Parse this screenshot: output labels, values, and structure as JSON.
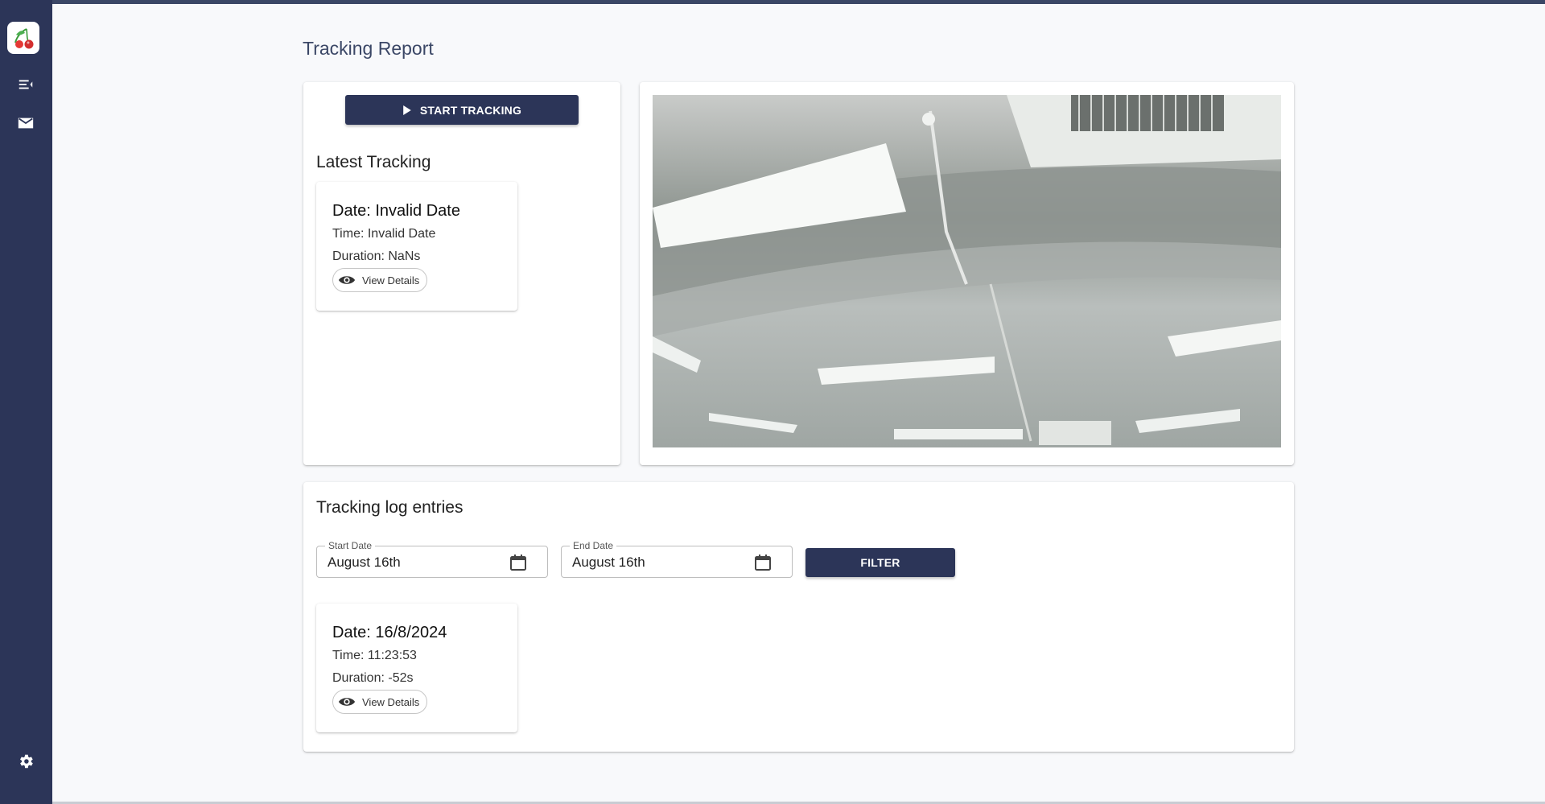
{
  "sidebar": {
    "logo_icon": "cherry-logo",
    "items": [
      {
        "icon": "menu-collapse-icon"
      },
      {
        "icon": "mail-icon"
      }
    ],
    "footer_icon": "gear-icon",
    "color": "#2c3558"
  },
  "page": {
    "title": "Tracking Report"
  },
  "tracking_panel": {
    "start_button_label": "START TRACKING",
    "latest_title": "Latest Tracking",
    "latest": {
      "date": "Date: Invalid Date",
      "time": "Time: Invalid Date",
      "duration": "Duration: NaNs",
      "view_label": "View Details"
    }
  },
  "camera_feed": {
    "description_icon": "camera-feed"
  },
  "log_section": {
    "title": "Tracking log entries",
    "start_date": {
      "label": "Start Date",
      "value": "August 16th"
    },
    "end_date": {
      "label": "End Date",
      "value": "August 16th"
    },
    "filter_label": "FILTER",
    "entries": [
      {
        "date": "Date: 16/8/2024",
        "time": "Time: 11:23:53",
        "duration": "Duration: -52s",
        "view_label": "View Details"
      }
    ]
  },
  "colors": {
    "primary": "#2c3558",
    "title": "#3b4766",
    "background": "#f8f9fb"
  }
}
